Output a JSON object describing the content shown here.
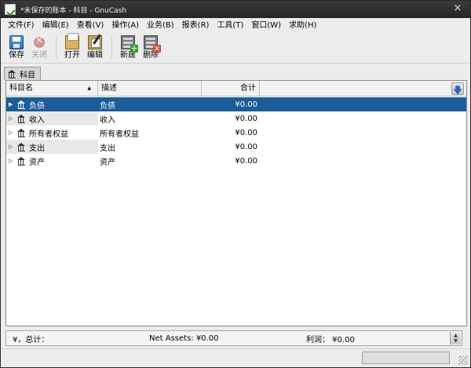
{
  "window": {
    "title": "*未保存的账本 - 科目 - GnuCash",
    "close_glyph": "×"
  },
  "menu": [
    "文件(F)",
    "编辑(E)",
    "查看(V)",
    "操作(A)",
    "业务(B)",
    "报表(R)",
    "工具(T)",
    "窗口(W)",
    "求助(H)"
  ],
  "toolbar": {
    "save": "保存",
    "close": "关闭",
    "open": "打开",
    "edit": "编辑",
    "new": "新建",
    "delete": "删除"
  },
  "tab": {
    "label": "科目"
  },
  "columns": {
    "name": "科目名",
    "description": "描述",
    "total": "合计"
  },
  "accounts": [
    {
      "name": "负债",
      "description": "负债",
      "total": "¥0.00",
      "selected": true
    },
    {
      "name": "收入",
      "description": "收入",
      "total": "¥0.00"
    },
    {
      "name": "所有者权益",
      "description": "所有者权益",
      "total": "¥0.00"
    },
    {
      "name": "支出",
      "description": "支出",
      "total": "¥0.00"
    },
    {
      "name": "资产",
      "description": "资产",
      "total": "¥0.00"
    }
  ],
  "summary": {
    "currency_total": "¥，总计：",
    "net_assets": "Net Assets: ¥0.00",
    "profit": "利润：  ¥0.00"
  },
  "colors": {
    "selection": "#1c5d99",
    "titlebar": "#2e2e2e"
  }
}
